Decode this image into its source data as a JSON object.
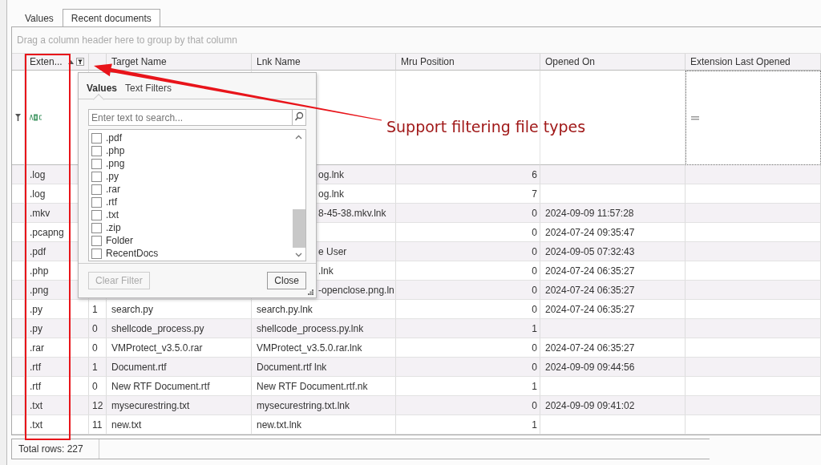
{
  "tabs": [
    {
      "label": "Values",
      "selected": false
    },
    {
      "label": "Recent documents",
      "selected": true
    }
  ],
  "group_panel": {
    "hint": "Drag a column header here to group by that column"
  },
  "grid": {
    "columns": [
      {
        "label": "Exten...",
        "sorted": true,
        "filtered": true
      },
      {
        "label": "Target Name"
      },
      {
        "label": "Lnk Name"
      },
      {
        "label": "Mru Position"
      },
      {
        "label": "Opened On"
      },
      {
        "label": "Extension Last Opened"
      }
    ],
    "rows": [
      {
        "ext": ".log",
        "lnk": "og.lnk",
        "mru": "6",
        "partial": true
      },
      {
        "ext": ".log",
        "lnk": "og.lnk",
        "mru": "7",
        "partial": true
      },
      {
        "ext": ".mkv",
        "lnk": "8-45-38.mkv.lnk",
        "mru": "0",
        "opened": "2024-09-09 11:57:28",
        "partial": true
      },
      {
        "ext": ".pcapng",
        "mru": "0",
        "opened": "2024-07-24 09:35:47"
      },
      {
        "ext": ".pdf",
        "lnk": "e User",
        "mru": "0",
        "opened": "2024-09-05 07:32:43",
        "partial": true
      },
      {
        "ext": ".php",
        "lnk": ".lnk",
        "mru": "0",
        "opened": "2024-07-24 06:35:27",
        "partial": true
      },
      {
        "ext": ".png",
        "lnk": "-openclose.png.ln",
        "mru": "0",
        "opened": "2024-07-24 06:35:27",
        "partial": true
      },
      {
        "ext": ".py",
        "num": "1",
        "target": "search.py",
        "lnk": "search.py.lnk",
        "mru": "0",
        "opened": "2024-07-24 06:35:27",
        "partial": false
      },
      {
        "ext": ".py",
        "num": "0",
        "target": "shellcode_process.py",
        "lnk": "shellcode_process.py.lnk",
        "mru": "1",
        "partial": false
      },
      {
        "ext": ".rar",
        "num": "0",
        "target": "VMProtect_v3.5.0.rar",
        "lnk": "VMProtect_v3.5.0.rar.lnk",
        "mru": "0",
        "opened": "2024-07-24 06:35:27",
        "partial": false
      },
      {
        "ext": ".rtf",
        "num": "1",
        "target": "Document.rtf",
        "lnk": "Document.rtf lnk",
        "mru": "0",
        "opened": "2024-09-09 09:44:56",
        "partial": false
      },
      {
        "ext": ".rtf",
        "num": "0",
        "target": "New RTF Document.rtf",
        "lnk": "New RTF Document.rtf.nk",
        "mru": "1",
        "partial": false
      },
      {
        "ext": ".txt",
        "num": "12",
        "target": "mysecurestring.txt",
        "lnk": "mysecurestring.txt.lnk",
        "mru": "0",
        "opened": "2024-09-09 09:41:02",
        "partial": false
      },
      {
        "ext": ".txt",
        "num": "11",
        "target": "new.txt",
        "lnk": "new.txt.lnk",
        "mru": "1",
        "partial": false
      }
    ]
  },
  "filter_popup": {
    "tabs": [
      {
        "label": "Values",
        "selected": true
      },
      {
        "label": "Text Filters",
        "selected": false
      }
    ],
    "search": {
      "placeholder": "Enter text to search..."
    },
    "values": [
      {
        "label": ".pdf",
        "checked": false
      },
      {
        "label": ".php",
        "checked": false
      },
      {
        "label": ".png",
        "checked": false
      },
      {
        "label": ".py",
        "checked": false
      },
      {
        "label": ".rar",
        "checked": false
      },
      {
        "label": ".rtf",
        "checked": false
      },
      {
        "label": ".txt",
        "checked": false
      },
      {
        "label": ".zip",
        "checked": false
      },
      {
        "label": "Folder",
        "checked": false
      },
      {
        "label": "RecentDocs",
        "checked": false
      }
    ],
    "buttons": [
      {
        "label": "Clear Filter",
        "disabled": true
      },
      {
        "label": "Close",
        "disabled": false
      }
    ]
  },
  "status_bar": {
    "total": "Total rows: 227"
  },
  "annotation": {
    "text": "Support filtering file types"
  }
}
